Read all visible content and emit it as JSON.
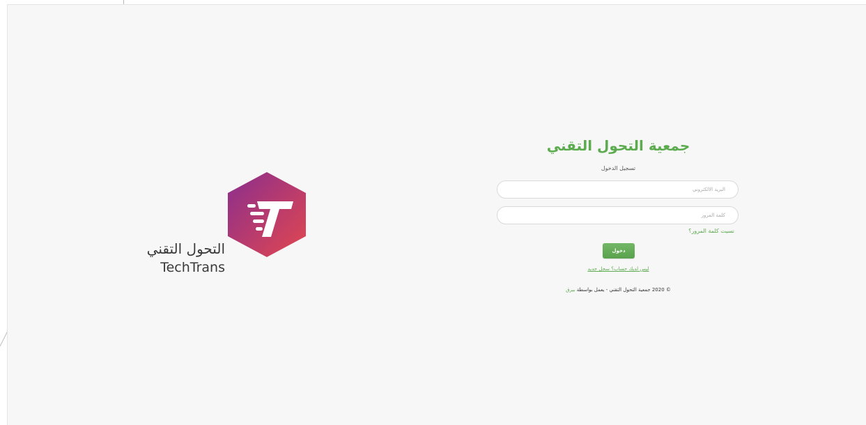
{
  "brand": {
    "name_ar": "التحول التقني",
    "name_en": "TechTrans",
    "gradient": [
      "#8a2e8e",
      "#e2474f"
    ]
  },
  "login": {
    "title": "جمعية التحول التقني",
    "subtitle": "تسجيل الدخول",
    "email_placeholder": "البريد الالكتروني",
    "password_placeholder": "كلمة المرور",
    "forgot_link": "نسيت كلمة المرور؟",
    "submit_label": "دخول",
    "register_link": "ليس لديك حساب؟ سجل جديد",
    "footer_text": "© 2020 جمعية التحول التقني - يعمل بواسطة",
    "powered_by": "بيرق"
  },
  "colors": {
    "accent": "#5cab4f",
    "background": "#f7f7f7"
  }
}
